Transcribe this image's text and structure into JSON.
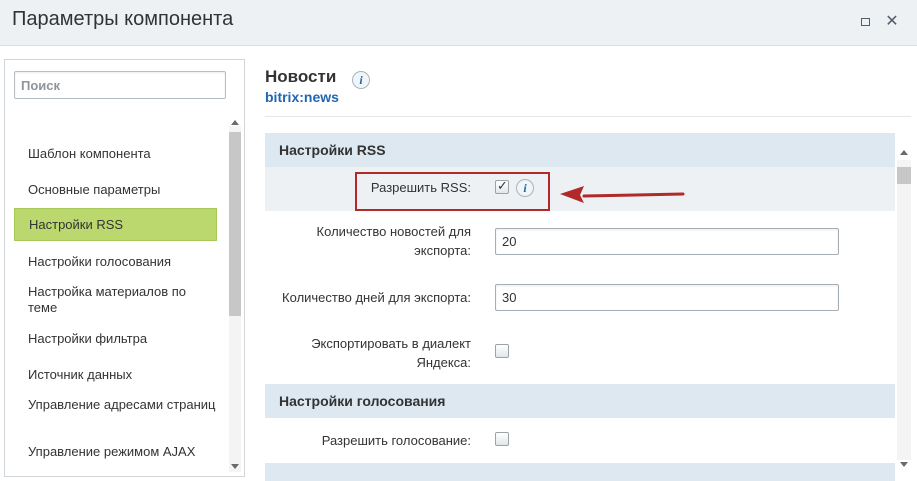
{
  "window": {
    "title": "Параметры компонента",
    "maximize_icon": "maximize-icon",
    "close_icon": "close-icon",
    "close_glyph": "✕"
  },
  "sidebar": {
    "search_placeholder": "Поиск",
    "items": [
      {
        "label": "Шаблон компонента",
        "active": false
      },
      {
        "label": "Основные параметры",
        "active": false
      },
      {
        "label": "Настройки RSS",
        "active": true
      },
      {
        "label": "Настройки голосования",
        "active": false
      },
      {
        "label": "Настройка материалов по теме",
        "active": false
      },
      {
        "label": "Настройки фильтра",
        "active": false
      },
      {
        "label": "Источник данных",
        "active": false
      },
      {
        "label": "Управление адресами страниц",
        "active": false
      },
      {
        "label": "Управление режимом AJAX",
        "active": false
      }
    ]
  },
  "component": {
    "title": "Новости",
    "code": "bitrix:news",
    "info_icon": "info-icon",
    "info_glyph": "i"
  },
  "sections": {
    "rss": {
      "title": "Настройки RSS",
      "allow_rss_label": "Разрешить RSS:",
      "allow_rss_checked": true,
      "news_count_label": "Количество новостей для экспорта:",
      "news_count_value": "20",
      "days_count_label": "Количество дней для экспорта:",
      "days_count_value": "30",
      "yandex_label": "Экспортировать в диалект Яндекса:",
      "yandex_checked": false
    },
    "voting": {
      "title": "Настройки голосования",
      "allow_voting_label": "Разрешить голосование:",
      "allow_voting_checked": false
    }
  },
  "colors": {
    "active_item": "#bbd86e",
    "section_header": "#dde8f1",
    "link": "#2067b0",
    "annotation": "#b02a2a"
  }
}
